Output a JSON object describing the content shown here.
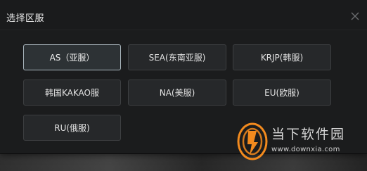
{
  "dialog": {
    "title": "选择区服"
  },
  "regions": [
    {
      "label": "AS（亚服）",
      "selected": true
    },
    {
      "label": "SEA(东南亚服)",
      "selected": false
    },
    {
      "label": "KRJP(韩服)",
      "selected": false
    },
    {
      "label": "韩国KAKAO服",
      "selected": false
    },
    {
      "label": "NA(美服)",
      "selected": false
    },
    {
      "label": "EU(欧服)",
      "selected": false
    },
    {
      "label": "RU(俄服)",
      "selected": false
    }
  ],
  "watermark": {
    "brand": "当下软件园",
    "url": "www.downxia.com"
  },
  "colors": {
    "dialog_bg": "#1b1c1d",
    "button_bg": "#26282a",
    "button_border": "#3d3f41",
    "selected_border": "#a9b6bd",
    "watermark_orange": "#f28a1e"
  }
}
